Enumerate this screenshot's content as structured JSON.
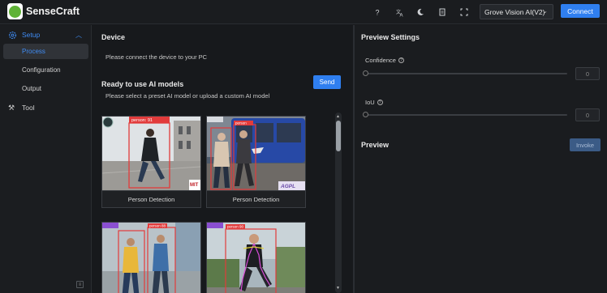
{
  "header": {
    "brand": "SenseCraft",
    "icons": [
      "help-icon",
      "translate-icon",
      "dark-mode-icon",
      "document-icon",
      "fullscreen-icon"
    ],
    "device_select": "Grove Vision AI(V2)",
    "connect_label": "Connect"
  },
  "sidebar": {
    "setup_label": "Setup",
    "items": [
      {
        "label": "Process"
      },
      {
        "label": "Configuration"
      },
      {
        "label": "Output"
      }
    ],
    "tool_label": "Tool"
  },
  "device": {
    "title": "Device",
    "message": "Please connect the device to your PC"
  },
  "models": {
    "title": "Ready to use AI models",
    "subtitle": "Please select a preset AI model or upload a custom AI model",
    "send_label": "Send",
    "cards": [
      {
        "name": "Person Detection",
        "box_label": "person: 91",
        "badge": "MIT"
      },
      {
        "name": "Person Detection",
        "box_label": "person",
        "badge": "AGPL"
      },
      {
        "name": "",
        "box_label": "person 88",
        "badge": ""
      },
      {
        "name": "",
        "box_label": "person 90",
        "badge": ""
      }
    ]
  },
  "preview_settings": {
    "title": "Preview Settings",
    "confidence_label": "Confidence",
    "confidence_value": "0",
    "iou_label": "IoU",
    "iou_value": "0"
  },
  "preview": {
    "title": "Preview",
    "invoke_label": "Invoke"
  },
  "colors": {
    "accent": "#2f7ff0",
    "background": "#17191c",
    "box": "#e23b3b"
  }
}
